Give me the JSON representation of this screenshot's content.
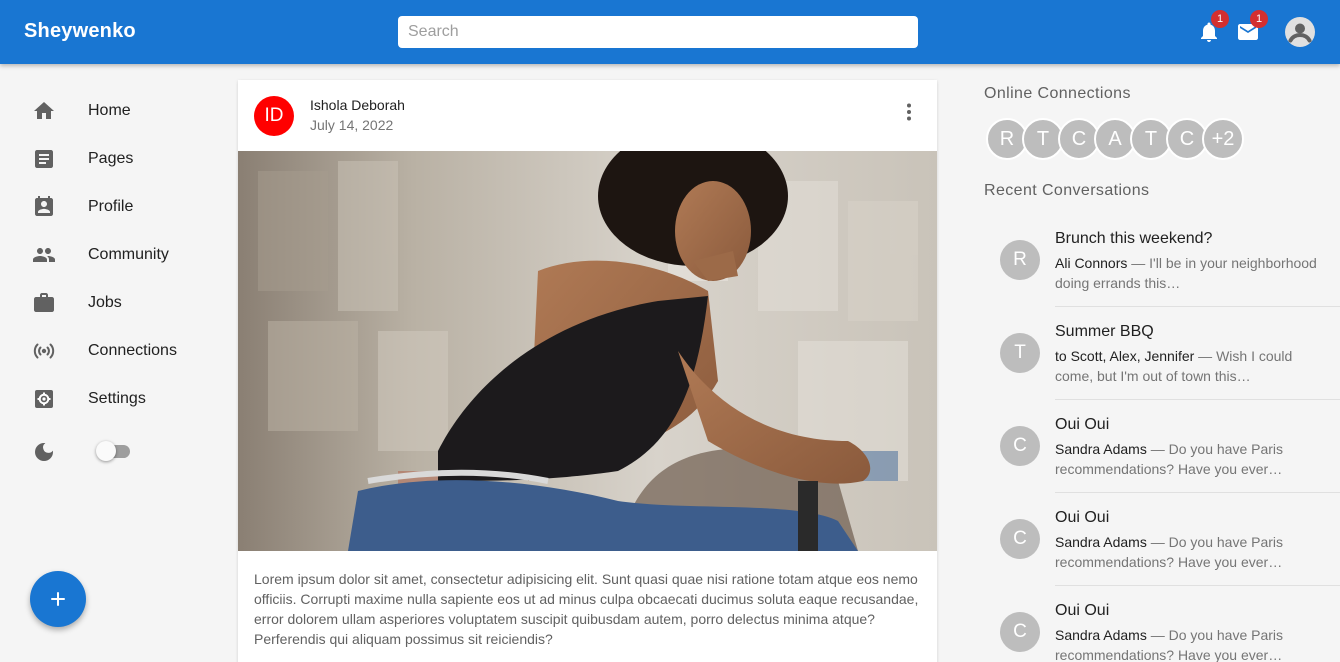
{
  "app": {
    "title": "Sheywenko",
    "brand_color": "#1976d2"
  },
  "search": {
    "placeholder": "Search",
    "value": ""
  },
  "appbar": {
    "notifications": {
      "icon": "bell-icon",
      "count": "1"
    },
    "messages": {
      "icon": "mail-icon",
      "count": "1"
    },
    "account": {
      "icon": "account-circle-icon"
    }
  },
  "sidebar": {
    "items": [
      {
        "label": "Home",
        "icon": "home-icon"
      },
      {
        "label": "Pages",
        "icon": "article-icon"
      },
      {
        "label": "Profile",
        "icon": "contact-page-icon"
      },
      {
        "label": "Community",
        "icon": "group-icon"
      },
      {
        "label": "Jobs",
        "icon": "briefcase-icon"
      },
      {
        "label": "Connections",
        "icon": "broadcast-icon"
      },
      {
        "label": "Settings",
        "icon": "settings-icon"
      }
    ],
    "dark_mode": {
      "icon": "moon-icon",
      "enabled": false
    }
  },
  "fab": {
    "icon": "add-icon",
    "label": "+"
  },
  "post": {
    "avatar_initials": "ID",
    "avatar_color": "#ff0000",
    "author": "Ishola Deborah",
    "date": "July 14, 2022",
    "body": "Lorem ipsum dolor sit amet, consectetur adipisicing elit. Sunt quasi quae nisi ratione totam atque eos nemo officiis. Corrupti maxime nulla sapiente eos ut ad minus culpa obcaecati ducimus soluta eaque recusandae, error dolorem ullam asperiores voluptatem suscipit quibusdam autem, porro delectus minima atque? Perferendis qui aliquam possimus sit reiciendis?"
  },
  "online": {
    "title": "Online Connections",
    "avatars": [
      "R",
      "T",
      "C",
      "A",
      "T",
      "C"
    ],
    "more": "+2"
  },
  "recent": {
    "title": "Recent Conversations",
    "items": [
      {
        "initial": "R",
        "title": "Brunch this weekend?",
        "who": "Ali Connors",
        "sep": " — ",
        "message": "I'll be in your neighborhood doing errands this…"
      },
      {
        "initial": "T",
        "title": "Summer BBQ",
        "who": "to Scott, Alex, Jennifer",
        "sep": " — ",
        "message": "Wish I could come, but I'm out of town this…"
      },
      {
        "initial": "C",
        "title": "Oui Oui",
        "who": "Sandra Adams",
        "sep": " — ",
        "message": "Do you have Paris recommendations? Have you ever…"
      },
      {
        "initial": "C",
        "title": "Oui Oui",
        "who": "Sandra Adams",
        "sep": " — ",
        "message": "Do you have Paris recommendations? Have you ever…"
      },
      {
        "initial": "C",
        "title": "Oui Oui",
        "who": "Sandra Adams",
        "sep": " — ",
        "message": "Do you have Paris recommendations? Have you ever…"
      }
    ]
  }
}
